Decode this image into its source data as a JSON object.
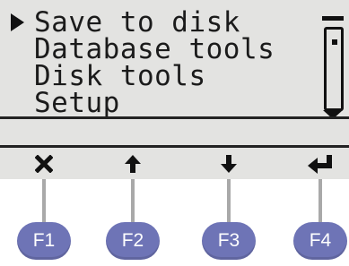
{
  "menu": {
    "items": [
      {
        "label": "Save to disk",
        "selected": true
      },
      {
        "label": "Database tools",
        "selected": false
      },
      {
        "label": "Disk tools",
        "selected": false
      },
      {
        "label": "Setup",
        "selected": false
      }
    ]
  },
  "status_line": "",
  "softkeys": [
    {
      "icon": "close-icon",
      "function_key": "F1"
    },
    {
      "icon": "arrow-up-icon",
      "function_key": "F2"
    },
    {
      "icon": "arrow-down-icon",
      "function_key": "F3"
    },
    {
      "icon": "enter-icon",
      "function_key": "F4"
    }
  ],
  "colors": {
    "lcd_background": "#e3e3e1",
    "lcd_text": "#1b1b1b",
    "fkey_background": "#6e74b6",
    "connector": "#a9a9a9"
  }
}
